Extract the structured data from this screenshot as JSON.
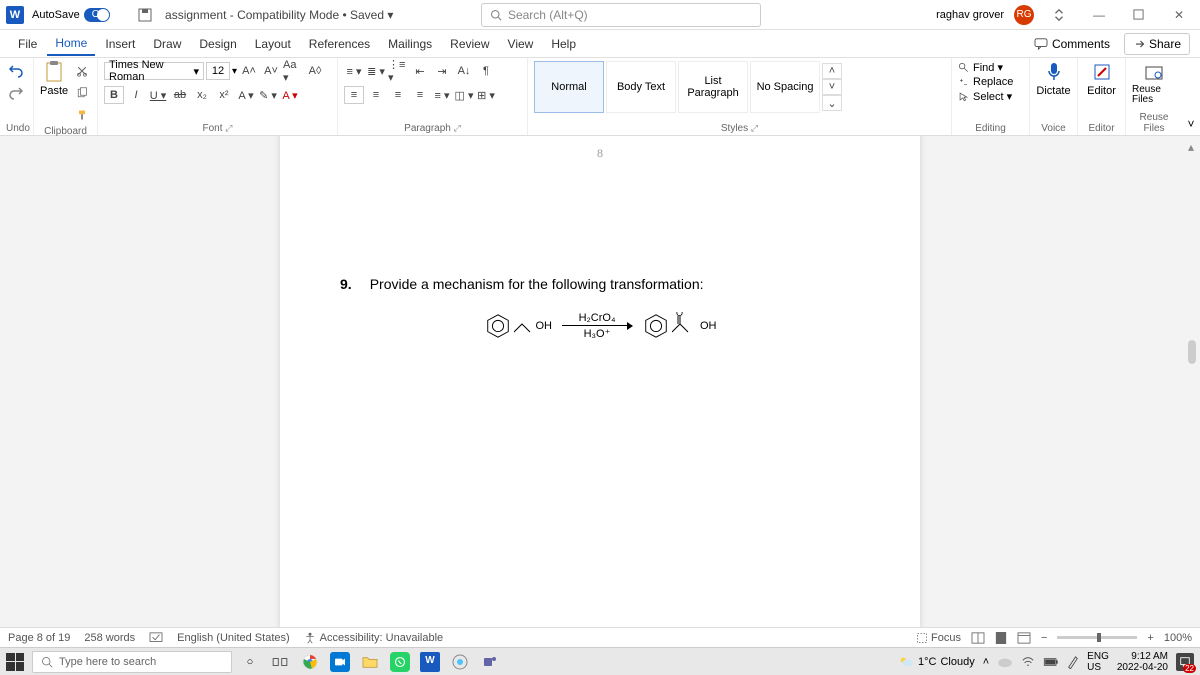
{
  "titlebar": {
    "word_logo": "W",
    "autosave_label": "AutoSave",
    "autosave_state": "On",
    "doc_title": "assignment - Compatibility Mode • Saved ▾",
    "search_placeholder": "Search (Alt+Q)",
    "user_name": "raghav grover",
    "user_initials": "RG"
  },
  "menu": {
    "items": [
      "File",
      "Home",
      "Insert",
      "Draw",
      "Design",
      "Layout",
      "References",
      "Mailings",
      "Review",
      "View",
      "Help"
    ],
    "active_index": 1,
    "comments": "Comments",
    "share": "Share"
  },
  "ribbon": {
    "undo_label": "Undo",
    "clipboard": {
      "paste": "Paste",
      "label": "Clipboard"
    },
    "font": {
      "name": "Times New Roman",
      "size": "12",
      "increase": "A˄",
      "decrease": "A˅",
      "case": "Aa ▾",
      "clear": "A◊",
      "bold": "B",
      "italic": "I",
      "underline": "U ▾",
      "strike": "ab",
      "sub": "x₂",
      "sup": "x²",
      "effects": "A ▾",
      "highlight": "✎ ▾",
      "color": "A ▾",
      "label": "Font"
    },
    "paragraph": {
      "bullets": "≡ ▾",
      "numbers": "≣ ▾",
      "multi": "⋮≡ ▾",
      "dec_indent": "⇤",
      "inc_indent": "⇥",
      "sort": "A↓",
      "marks": "¶",
      "left": "≡",
      "center": "≡",
      "right": "≡",
      "justify": "≡",
      "spacing": "≡ ▾",
      "shading": "◫ ▾",
      "borders": "⊞ ▾",
      "label": "Paragraph"
    },
    "styles": {
      "items": [
        "Normal",
        "Body Text",
        "List Paragraph",
        "No Spacing"
      ],
      "label": "Styles"
    },
    "editing": {
      "find": "Find ▾",
      "replace": "Replace",
      "select": "Select ▾",
      "label": "Editing"
    },
    "voice": {
      "dictate": "Dictate",
      "label": "Voice"
    },
    "editor": {
      "editor": "Editor",
      "label": "Editor"
    },
    "reuse": {
      "reuse": "Reuse Files",
      "label": "Reuse Files"
    }
  },
  "document": {
    "header_page": "8",
    "q_number": "9.",
    "q_text": "Provide a mechanism for the following transformation:",
    "left_label": "OH",
    "over_arrow": "H₂CrO₄",
    "under_arrow": "H₃O⁺",
    "right_label": "OH"
  },
  "statusbar": {
    "page": "Page 8 of 19",
    "words": "258 words",
    "lang": "English (United States)",
    "access": "Accessibility: Unavailable",
    "focus": "Focus",
    "zoom": "100%"
  },
  "taskbar": {
    "search": "Type here to search",
    "weather_temp": "1°C",
    "weather_label": "Cloudy",
    "lang1": "ENG",
    "lang2": "US",
    "time": "9:12 AM",
    "date": "2022-04-20",
    "notif_count": "22"
  }
}
